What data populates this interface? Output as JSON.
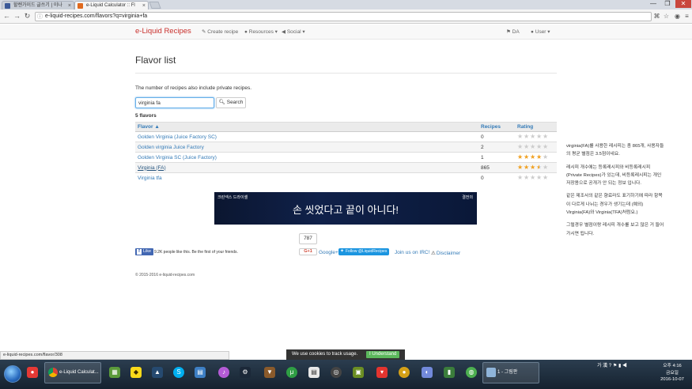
{
  "browser": {
    "tabs": [
      {
        "title": "할렌가이드 글쓰기 | 이나",
        "active": false,
        "favicon_color": "#3b5998"
      },
      {
        "title": "e-Liquid Calculator :: Fl",
        "active": true,
        "favicon_color": "#e06a1f"
      }
    ],
    "url": "e-liquid-recipes.com/flavors?q=virginia+fa",
    "window_controls": {
      "minimize": "—",
      "maximize": "❐",
      "close": "✕"
    }
  },
  "site_nav": {
    "brand": "e-Liquid Recipes",
    "create": "Create recipe",
    "resources": "Resources",
    "social": "Social",
    "language": "DA",
    "user": "User"
  },
  "page": {
    "title": "Flavor list",
    "note": "The number of recipes also include private recipes.",
    "search": {
      "value": "virginia fa",
      "button": "Search"
    },
    "count": "5 flavors",
    "table": {
      "headers": {
        "flavor": "Flavor",
        "recipes": "Recipes",
        "rating": "Rating"
      },
      "rows": [
        {
          "name": "Golden Virginia (Juice Factory SC)",
          "recipes": "0",
          "rating": 0
        },
        {
          "name": "Golden virginia Juice Factory",
          "recipes": "2",
          "rating": 0
        },
        {
          "name": "Golden Virginia SC (Juice Factory)",
          "recipes": "1",
          "rating": 4
        },
        {
          "name": "Virginia (FA)",
          "recipes": "865",
          "rating": 3.5
        },
        {
          "name": "Virginia tfa",
          "recipes": "0",
          "rating": 0
        }
      ]
    },
    "ad": {
      "brand": "크린넥스 드라이셀",
      "tag": "결전의",
      "text": "손 씻었다고 끝이 아니다!"
    },
    "social": {
      "counter": "787",
      "fb_like": "Like",
      "fb_text": "9.2K people like this. Be the first of your friends.",
      "gplus": "G+1",
      "google_link": "Google+",
      "twitter_follow": "Follow @LiquidRecipes",
      "irc": "Join us on IRC!",
      "disclaimer": "Disclaimer"
    },
    "copyright": "© 2015-2016 e-liquid-recipes.com"
  },
  "side_note": {
    "p1": "virginia(FA)를 사용한 레시피는 총 865개, 사용자들의 평균 별점은 3.5점이네요.",
    "p2": "레시피 개수에는 등록레시피와 비등록레시피(Private Recipes)가 있는데, 비등록레시피는 개인 저장용으로 공개가 안 되는 정보 입니다.",
    "p3": "같은 제조사의 같은 향료라도 표기하기에 따라 항목이 다르게 나뉘는 경우가 생기는데 (예외) Virginia(FA)와 Virginia(TFA)처럼요.)",
    "p4": "그럴경우 별점이랑 레시피 개수를 보고 많은 거 들어가시면 됩니다."
  },
  "status": {
    "hover_url": "e-liquid-recipes.com/flavor/308",
    "cookie_text": "We use cookies to track usage.",
    "cookie_button": "I Understand"
  },
  "taskbar": {
    "chrome_window": "e-Liquid Calculat...",
    "paint_window": "1 - 그림판",
    "tray_lang": "가 漢",
    "time": "오후 4:16",
    "day": "금요일",
    "date": "2016-10-07"
  },
  "colors": {
    "brand_red": "#c9302c",
    "link_blue": "#337ab7",
    "star_gold": "#f0a020",
    "cookie_green": "#5cb85c"
  }
}
